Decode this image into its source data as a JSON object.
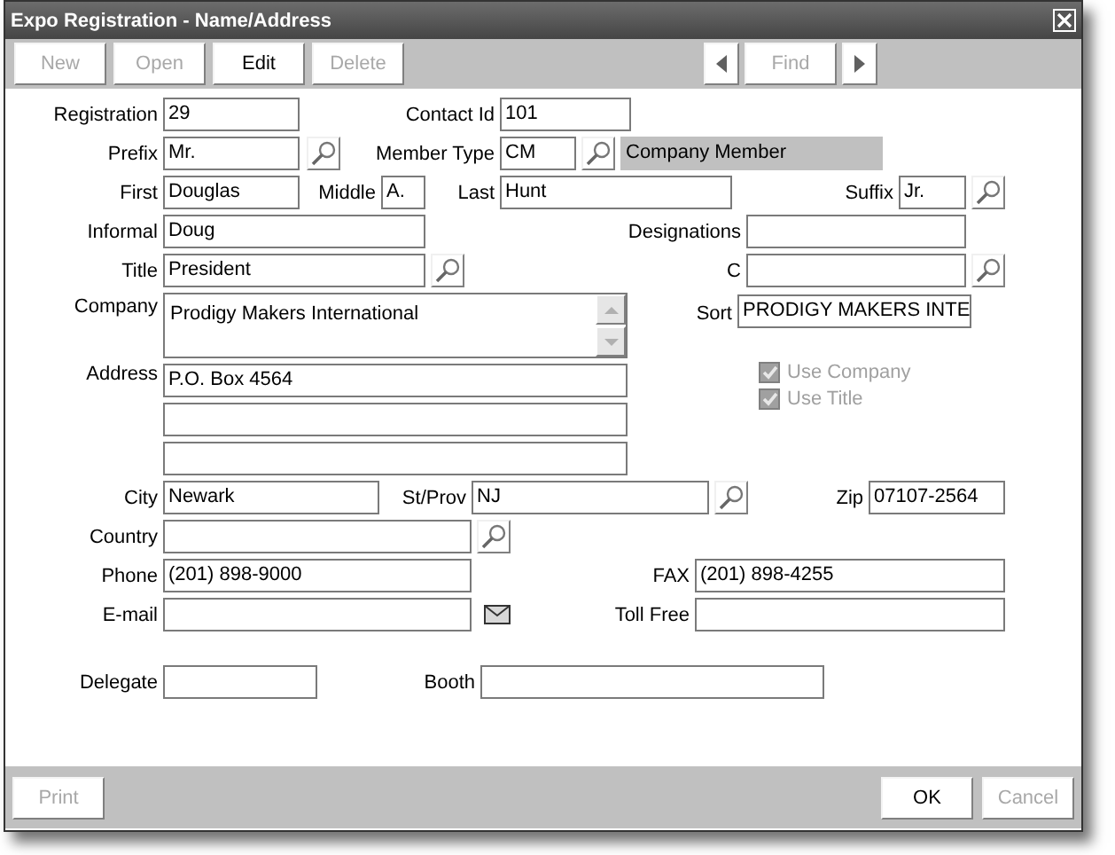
{
  "window": {
    "title": "Expo Registration - Name/Address"
  },
  "toolbar": {
    "buttons": [
      {
        "label": "New",
        "disabled": true
      },
      {
        "label": "Open",
        "disabled": true
      },
      {
        "label": "Edit",
        "disabled": false
      },
      {
        "label": "Delete",
        "disabled": true
      }
    ],
    "find": {
      "label": "Find",
      "disabled": true
    }
  },
  "form": {
    "registration": {
      "label": "Registration",
      "value": "29"
    },
    "contact_id": {
      "label": "Contact Id",
      "value": "101"
    },
    "prefix": {
      "label": "Prefix",
      "value": "Mr."
    },
    "member_type": {
      "label": "Member Type",
      "value": "CM",
      "description": "Company Member"
    },
    "first": {
      "label": "First",
      "value": "Douglas"
    },
    "middle": {
      "label": "Middle",
      "value": "A."
    },
    "last": {
      "label": "Last",
      "value": "Hunt"
    },
    "suffix": {
      "label": "Suffix",
      "value": "Jr."
    },
    "informal": {
      "label": "Informal",
      "value": "Doug"
    },
    "designations": {
      "label": "Designations"
    },
    "title": {
      "label": "Title",
      "value": "President"
    },
    "field_c": {
      "label": "C"
    },
    "company": {
      "label": "Company",
      "value": "Prodigy Makers International"
    },
    "sort": {
      "label": "Sort",
      "value": "PRODIGY MAKERS INTE"
    },
    "address": {
      "label": "Address",
      "value": "P.O. Box 4564"
    },
    "checkboxes": [
      {
        "label": "Use Company",
        "checked": true,
        "disabled": true
      },
      {
        "label": "Use Title",
        "checked": true,
        "disabled": true
      }
    ],
    "city": {
      "label": "City",
      "value": "Newark"
    },
    "st_prov": {
      "label": "St/Prov",
      "value": "NJ"
    },
    "zip": {
      "label": "Zip",
      "value": "07107-2564"
    },
    "country": {
      "label": "Country"
    },
    "phone": {
      "label": "Phone",
      "value": "(201) 898-9000"
    },
    "fax": {
      "label": "FAX",
      "value": "(201) 898-4255"
    },
    "email": {
      "label": "E-mail"
    },
    "toll_free": {
      "label": "Toll Free"
    },
    "delegate": {
      "label": "Delegate"
    },
    "booth": {
      "label": "Booth"
    }
  },
  "footer": {
    "print": {
      "label": "Print",
      "disabled": true
    },
    "ok": {
      "label": "OK",
      "disabled": false
    },
    "cancel": {
      "label": "Cancel",
      "disabled": true
    }
  }
}
